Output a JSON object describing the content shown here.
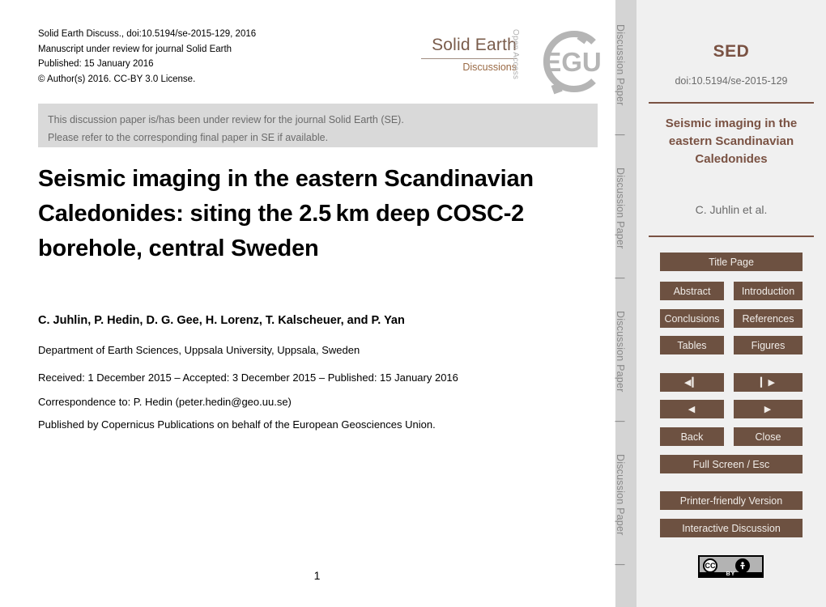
{
  "document": {
    "header_lines": [
      "Solid Earth Discuss., doi:10.5194/se-2015-129, 2016",
      "Manuscript under review for journal Solid Earth",
      "Published: 15 January 2016",
      "© Author(s) 2016. CC-BY 3.0 License."
    ],
    "journal_logo": {
      "name": "Solid Earth",
      "subtitle": "Discussions",
      "open_access": "Open Access",
      "egu_text": "EGU",
      "brand_color": "#7a5c4b",
      "logo_gray": "#b0b0b0"
    },
    "notice_lines": [
      "This discussion paper is/has been under review for the journal Solid Earth (SE).",
      "Please refer to the corresponding final paper in SE if available."
    ],
    "title": "Seismic imaging in the eastern Scandinavian Caledonides: siting the 2.5 km deep COSC-2 borehole, central Sweden",
    "authors": "C. Juhlin, P. Hedin, D. G. Gee, H. Lorenz, T. Kalscheuer, and P. Yan",
    "affiliation": "Department of Earth Sciences, Uppsala University, Uppsala, Sweden",
    "dates": "Received: 1 December 2015 – Accepted: 3 December 2015 – Published: 15 January 2016",
    "correspondence": "Correspondence to: P. Hedin (peter.hedin@geo.uu.se)",
    "publisher": "Published by Copernicus Publications on behalf of the European Geosciences Union.",
    "page_number": "1"
  },
  "spine": {
    "label": "Discussion Paper",
    "separator": "|"
  },
  "sidebar": {
    "journal_abbrev": "SED",
    "doi": "doi:10.5194/se-2015-129",
    "short_title": "Seismic imaging in the eastern Scandinavian Caledonides",
    "authors_short": "C. Juhlin et al.",
    "accent_color": "#7a5243",
    "button_color": "#6d5141",
    "buttons": {
      "title_page": "Title Page",
      "abstract": "Abstract",
      "introduction": "Introduction",
      "conclusions": "Conclusions",
      "references": "References",
      "tables": "Tables",
      "figures": "Figures",
      "first_page": "◀▎",
      "last_page": "▎▶",
      "prev_page": "◀",
      "next_page": "▶",
      "back": "Back",
      "close": "Close",
      "full_screen": "Full Screen / Esc",
      "printer_friendly": "Printer-friendly Version",
      "interactive_discussion": "Interactive Discussion"
    },
    "license_badge": {
      "cc": "CC",
      "by": "BY",
      "person": "ƒ"
    }
  }
}
